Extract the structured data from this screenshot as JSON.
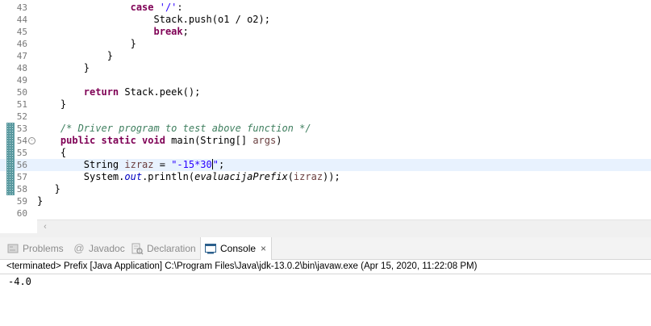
{
  "editor": {
    "lines": [
      {
        "num": "43",
        "tokens": [
          {
            "t": "                ",
            "c": ""
          },
          {
            "t": "case",
            "c": "kw"
          },
          {
            "t": " ",
            "c": ""
          },
          {
            "t": "'/'",
            "c": "str"
          },
          {
            "t": ":",
            "c": ""
          }
        ]
      },
      {
        "num": "44",
        "tokens": [
          {
            "t": "                    Stack.push(o1 / o2);",
            "c": ""
          }
        ]
      },
      {
        "num": "45",
        "tokens": [
          {
            "t": "                    ",
            "c": ""
          },
          {
            "t": "break",
            "c": "kw"
          },
          {
            "t": ";",
            "c": ""
          }
        ]
      },
      {
        "num": "46",
        "tokens": [
          {
            "t": "                }",
            "c": ""
          }
        ]
      },
      {
        "num": "47",
        "tokens": [
          {
            "t": "            }",
            "c": ""
          }
        ]
      },
      {
        "num": "48",
        "tokens": [
          {
            "t": "        }",
            "c": ""
          }
        ]
      },
      {
        "num": "49",
        "tokens": []
      },
      {
        "num": "50",
        "tokens": [
          {
            "t": "        ",
            "c": ""
          },
          {
            "t": "return",
            "c": "kw"
          },
          {
            "t": " Stack.peek();",
            "c": ""
          }
        ]
      },
      {
        "num": "51",
        "tokens": [
          {
            "t": "    }",
            "c": ""
          }
        ]
      },
      {
        "num": "52",
        "tokens": []
      },
      {
        "num": "53",
        "marker": true,
        "tokens": [
          {
            "t": "    ",
            "c": ""
          },
          {
            "t": "/* Driver program to test above function */",
            "c": "cmt"
          }
        ]
      },
      {
        "num": "54",
        "marker": true,
        "fold": "-",
        "tokens": [
          {
            "t": "    ",
            "c": ""
          },
          {
            "t": "public static void",
            "c": "kw"
          },
          {
            "t": " main(String[] ",
            "c": ""
          },
          {
            "t": "args",
            "c": "var"
          },
          {
            "t": ")",
            "c": ""
          }
        ]
      },
      {
        "num": "55",
        "marker": true,
        "tokens": [
          {
            "t": "    {",
            "c": ""
          }
        ]
      },
      {
        "num": "56",
        "marker": true,
        "current": true,
        "tokens": [
          {
            "t": "        String ",
            "c": ""
          },
          {
            "t": "izraz",
            "c": "var"
          },
          {
            "t": " = ",
            "c": ""
          },
          {
            "t": "\"-15*30",
            "c": "str"
          },
          {
            "t": "|",
            "c": "caret"
          },
          {
            "t": "\"",
            "c": "str"
          },
          {
            "t": ";",
            "c": ""
          }
        ]
      },
      {
        "num": "57",
        "marker": true,
        "tokens": [
          {
            "t": "        System.",
            "c": ""
          },
          {
            "t": "out",
            "c": "fld"
          },
          {
            "t": ".println(",
            "c": ""
          },
          {
            "t": "evaluacijaPrefix",
            "c": "mth"
          },
          {
            "t": "(",
            "c": ""
          },
          {
            "t": "izraz",
            "c": "var"
          },
          {
            "t": "));",
            "c": ""
          }
        ]
      },
      {
        "num": "58",
        "marker": true,
        "tokens": [
          {
            "t": "   }",
            "c": ""
          }
        ]
      },
      {
        "num": "59",
        "tokens": [
          {
            "t": "}",
            "c": ""
          }
        ]
      },
      {
        "num": "60",
        "tokens": []
      }
    ],
    "scroll_left_icon": "chevron-left-icon"
  },
  "panel": {
    "tabs": [
      {
        "label": "Problems",
        "icon": "problems-icon",
        "active": false
      },
      {
        "label": "Javadoc",
        "icon": "at-sign-icon",
        "active": false
      },
      {
        "label": "Declaration",
        "icon": "declaration-icon",
        "active": false
      },
      {
        "label": "Console",
        "icon": "console-icon",
        "active": true,
        "close": "×"
      }
    ],
    "status": "<terminated> Prefix [Java Application] C:\\Program Files\\Java\\jdk-13.0.2\\bin\\javaw.exe (Apr 15, 2020, 11:22:08 PM)",
    "output": "-4.0"
  },
  "colors": {
    "keyword": "#7f0055",
    "string": "#2a00ff",
    "comment": "#3f7f5f",
    "field": "#0000c0",
    "current_line": "#e8f2fe"
  }
}
